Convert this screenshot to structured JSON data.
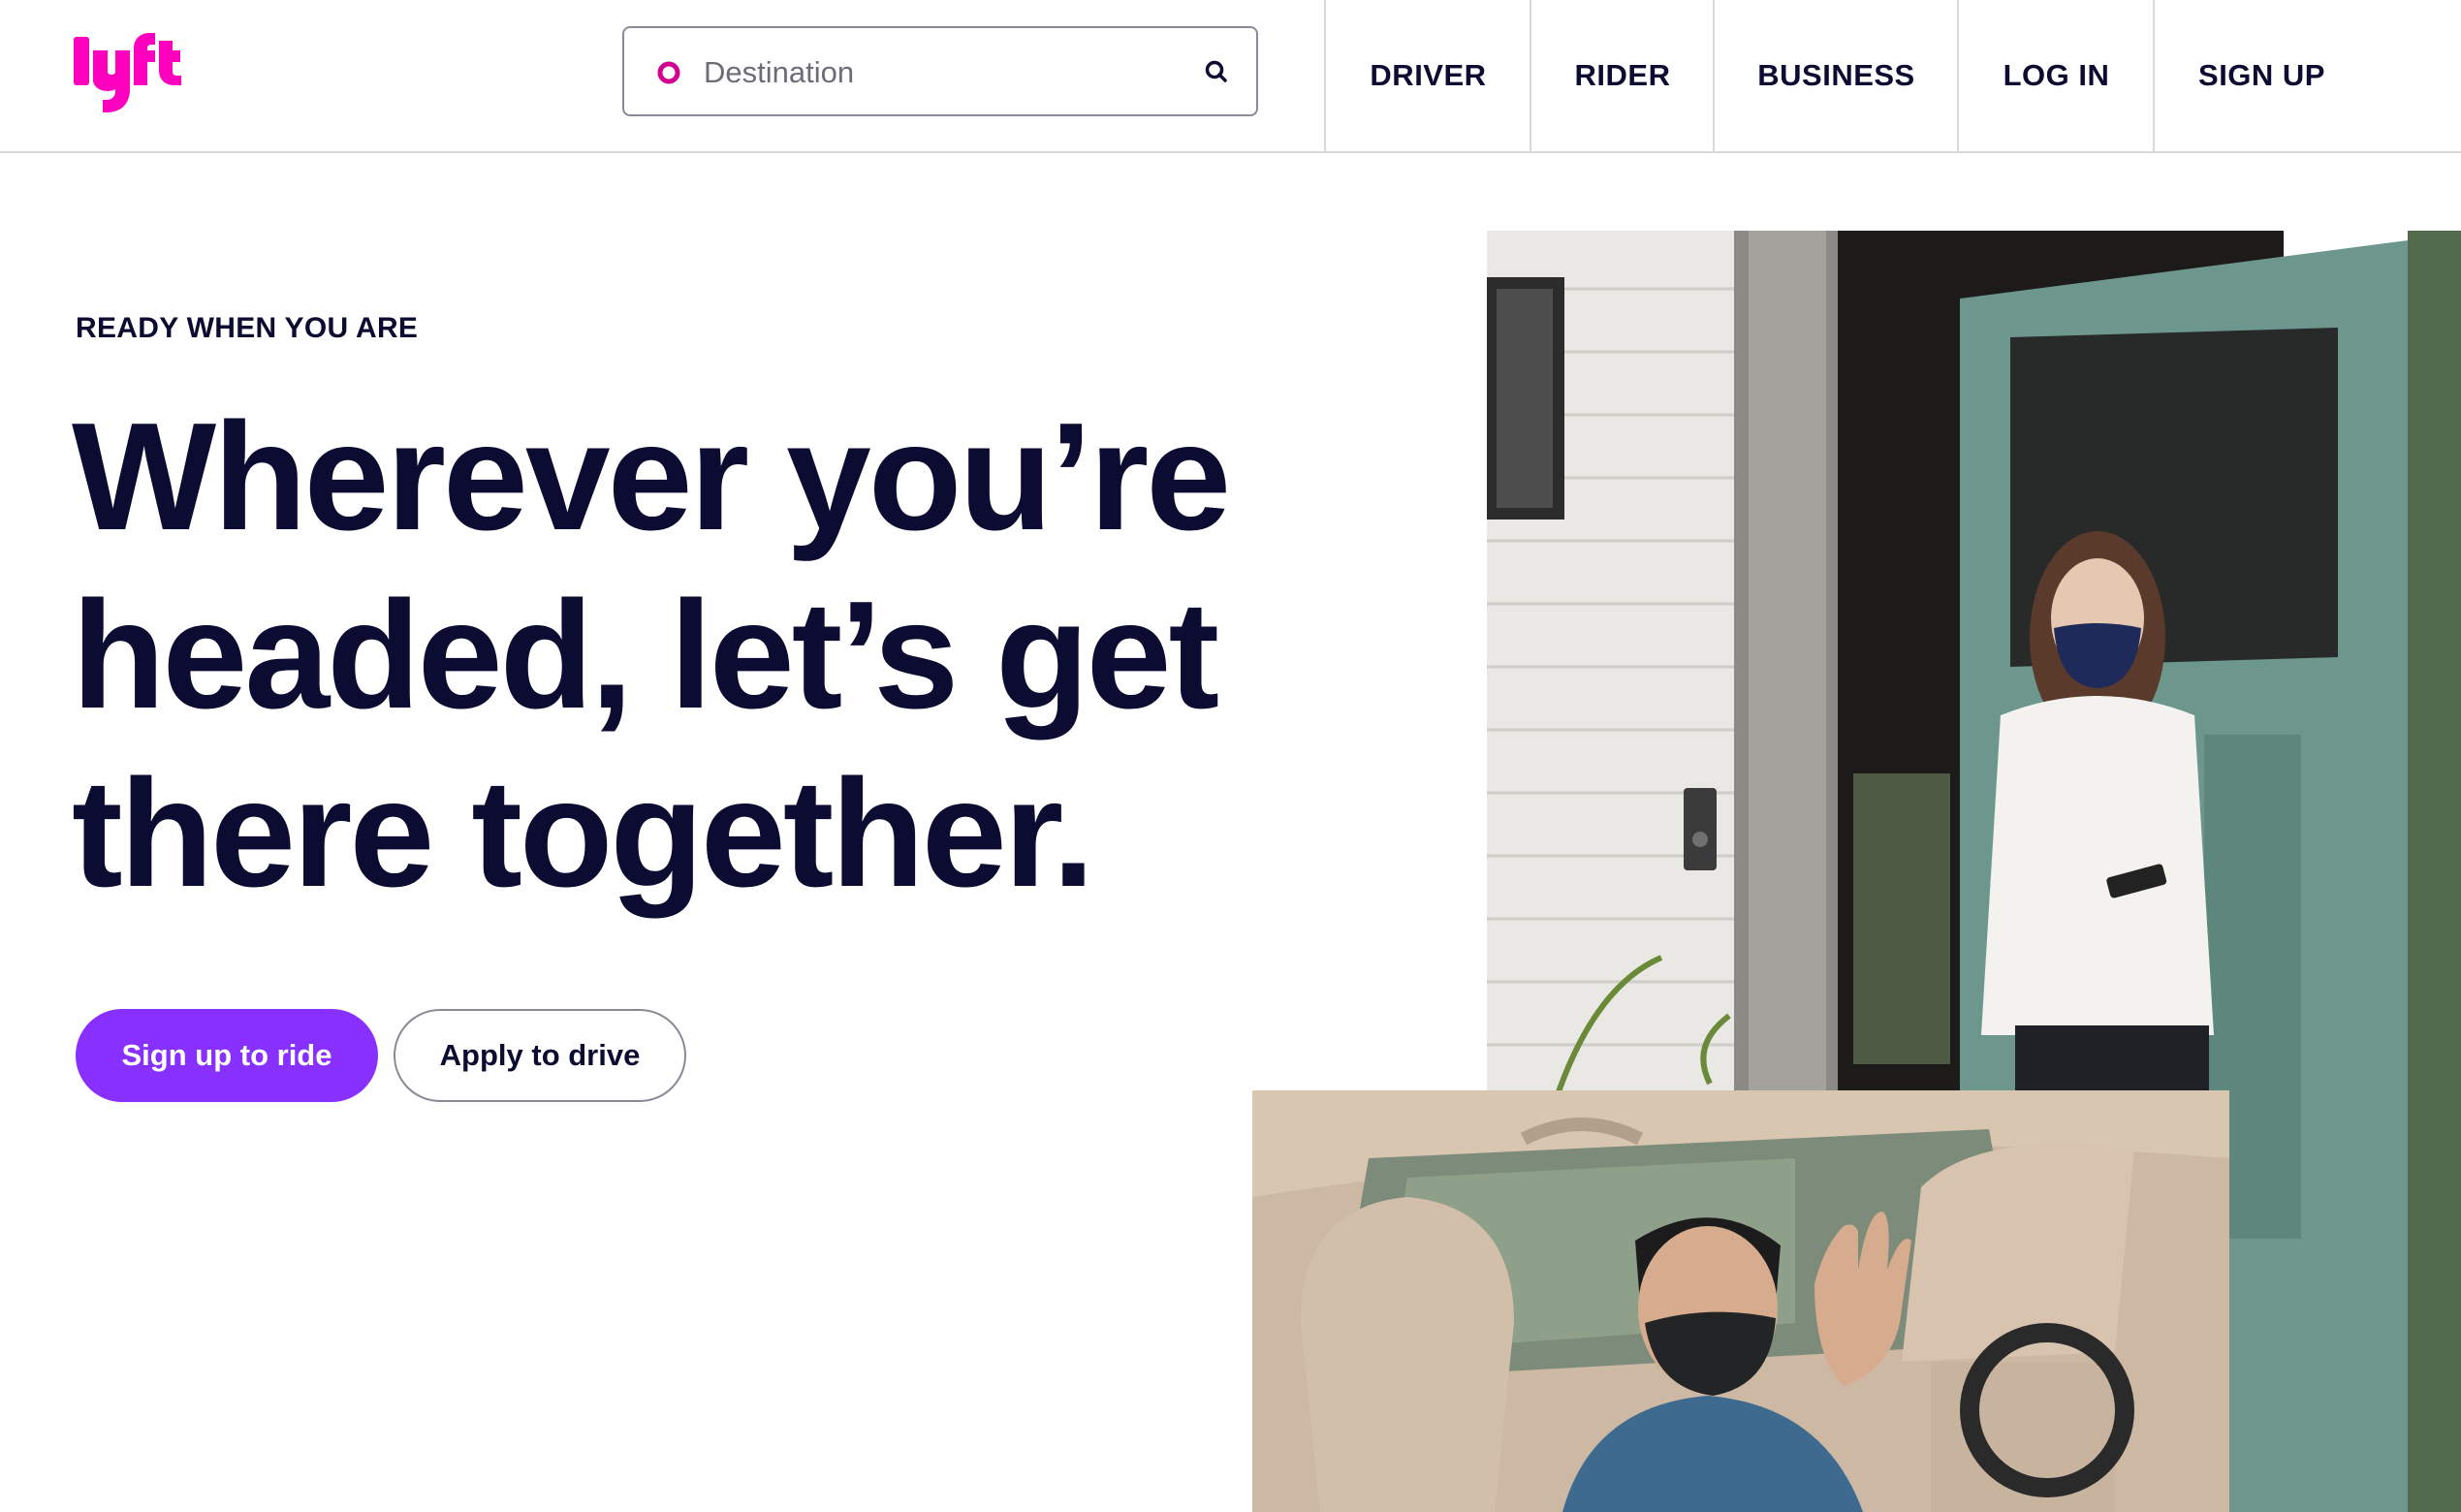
{
  "brand": {
    "logo_text": "lyft",
    "color": "#ff00bf"
  },
  "search": {
    "placeholder": "Destination",
    "value": "",
    "pin_icon": "location-pin-icon",
    "icon": "search-icon"
  },
  "nav": {
    "items": [
      {
        "label": "DRIVER"
      },
      {
        "label": "RIDER"
      },
      {
        "label": "BUSINESS"
      },
      {
        "label": "LOG IN"
      },
      {
        "label": "SIGN UP"
      }
    ]
  },
  "hero": {
    "eyebrow": "READY WHEN YOU ARE",
    "headline_lines": [
      "Wherever you’re",
      "headed, let’s get",
      "there together."
    ],
    "primary_button": "Sign up to ride",
    "secondary_button": "Apply to drive"
  },
  "images": {
    "door_photo": "woman-in-mask-at-door-photo",
    "car_photo": "driver-in-mask-waving-photo"
  },
  "colors": {
    "text": "#0c0b31",
    "accent_purple": "#8730ff",
    "brand_pink": "#ff00bf",
    "divider": "#d9d9dc"
  }
}
